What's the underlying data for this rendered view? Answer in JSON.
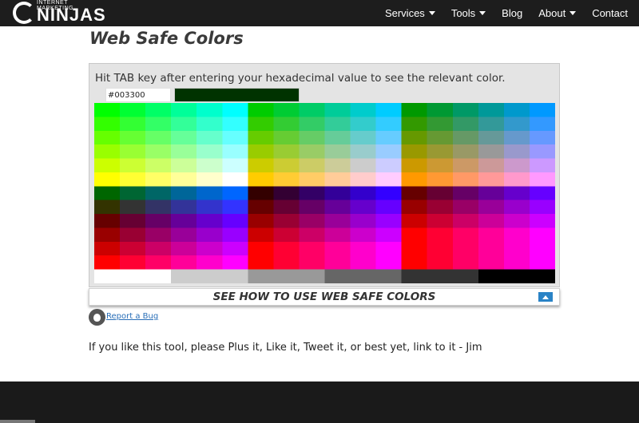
{
  "brand": {
    "logo_small": "INTERNET MARKETING",
    "logo_big": "NINJAS"
  },
  "nav": {
    "items": [
      {
        "label": "Services",
        "dropdown": true
      },
      {
        "label": "Tools",
        "dropdown": true
      },
      {
        "label": "Blog",
        "dropdown": false
      },
      {
        "label": "About",
        "dropdown": true
      },
      {
        "label": "Contact",
        "dropdown": false
      }
    ]
  },
  "page": {
    "title": "Web Safe Colors"
  },
  "tool": {
    "instruction": "Hit TAB key after entering your hexadecimal value to see the relevant color.",
    "hex_value": "#003300",
    "swatch_color": "#003300"
  },
  "howto": {
    "label": "SEE HOW TO USE WEB SAFE COLORS"
  },
  "report": {
    "label": "Report a Bug"
  },
  "like_message": "If you like this tool, please Plus it, Like it, Tweet it, or best yet, link to it - Jim",
  "colors": {
    "navbar_bg": "#1d1d1d",
    "link": "#2a6fb8",
    "accent_toggle": "#2a83c6",
    "footer_bg": "#1a1a1a"
  }
}
